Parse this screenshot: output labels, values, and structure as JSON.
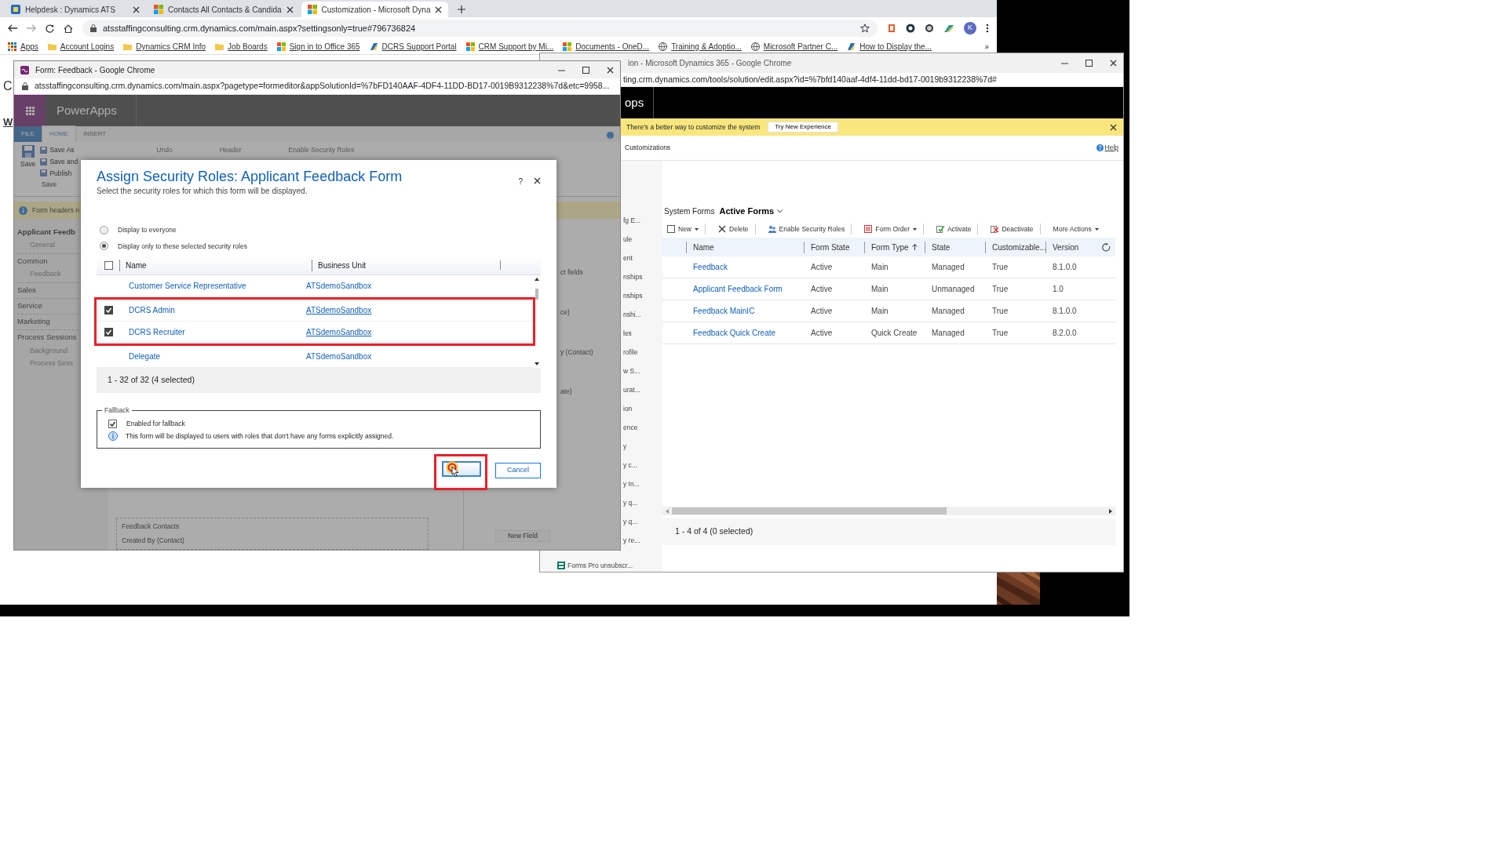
{
  "browser": {
    "tabs": [
      {
        "title": "Helpdesk : Dynamics ATS",
        "selected": false
      },
      {
        "title": "Contacts All Contacts & Candida",
        "selected": false
      },
      {
        "title": "Customization - Microsoft Dyna",
        "selected": true
      }
    ],
    "url": "atsstaffingconsulting.crm.dynamics.com/main.aspx?settingsonly=true#796736824",
    "profile_initial": "K",
    "bookmarks": [
      {
        "label": "Apps",
        "kind": "apps"
      },
      {
        "label": "Account Logins",
        "kind": "folder"
      },
      {
        "label": "Dynamics CRM Info",
        "kind": "folder"
      },
      {
        "label": "Job Boards",
        "kind": "folder"
      },
      {
        "label": "Sign in to Office 365",
        "kind": "windows"
      },
      {
        "label": "DCRS Support Portal",
        "kind": "site"
      },
      {
        "label": "CRM Support by Mi...",
        "kind": "windows"
      },
      {
        "label": "Documents - OneD...",
        "kind": "windows"
      },
      {
        "label": "Training & Adoptio...",
        "kind": "globe"
      },
      {
        "label": "Microsoft Partner C...",
        "kind": "globe"
      },
      {
        "label": "How to Display the...",
        "kind": "site"
      }
    ],
    "bookmarks_more": "»",
    "page_fragments": [
      "C",
      "W"
    ]
  },
  "solution_window": {
    "title": "ion - Microsoft Dynamics 365 - Google Chrome",
    "url": "ting.crm.dynamics.com/tools/solution/edit.aspx?id=%7bfd140aaf-4df4-11dd-bd17-0019b9312238%7d#",
    "app_name": "ops",
    "notice": "There's a better way to customize the system",
    "notice_button": "Try New Experience",
    "breadcrumb": "Customizations",
    "help": "Help",
    "nav_fragments": [
      "fg E...",
      "ule",
      "ent",
      "nships",
      "nships",
      "nshi...",
      "les",
      "rofile",
      "w S...",
      "urat...",
      "ion",
      "ence",
      "y",
      "y c...",
      "y In...",
      "y q...",
      "y q...",
      "y re..."
    ],
    "nav_tail": "Forms Pro unsubscr...",
    "view_label": "System Forms",
    "view_name": "Active Forms",
    "toolbar": [
      "New",
      "Delete",
      "Enable Security Roles",
      "Form Order",
      "Activate",
      "Deactivate",
      "More Actions"
    ],
    "columns": [
      "Name",
      "Form State",
      "Form Type",
      "State",
      "Customizable...",
      "Version"
    ],
    "rows": [
      {
        "name": "Feedback",
        "form_state": "Active",
        "form_type": "Main",
        "state": "Managed",
        "customizable": "True",
        "version": "8.1.0.0"
      },
      {
        "name": "Applicant Feedback Form",
        "form_state": "Active",
        "form_type": "Main",
        "state": "Unmanaged",
        "customizable": "True",
        "version": "1.0"
      },
      {
        "name": "Feedback MainIC",
        "form_state": "Active",
        "form_type": "Main",
        "state": "Managed",
        "customizable": "True",
        "version": "8.1.0.0"
      },
      {
        "name": "Feedback Quick Create",
        "form_state": "Active",
        "form_type": "Quick Create",
        "state": "Managed",
        "customizable": "True",
        "version": "8.2.0.0"
      }
    ],
    "footer": "1 - 4 of 4 (0 selected)"
  },
  "form_window": {
    "title": "Form: Feedback - Google Chrome",
    "url": "atsstaffingconsulting.crm.dynamics.com/main.aspx?pagetype=formeditor&appSolutionId=%7bFD140AAF-4DF4-11DD-BD17-0019B9312238%7d&etc=9958...",
    "app_name": "PowerApps",
    "ribbon_tabs": [
      {
        "label": "FILE",
        "selected": false
      },
      {
        "label": "HOME",
        "selected": true
      },
      {
        "label": "INSERT",
        "selected": false
      }
    ],
    "save_label": "Save",
    "save_commands": [
      "Save As",
      "Save and",
      "Publish"
    ],
    "group_label": "Save",
    "ribbon_more": [
      "Undo",
      "Header",
      "Enable Security Roles"
    ],
    "info": "Form headers n",
    "nav": [
      {
        "label": "Applicant Feedb",
        "children": [
          "General"
        ]
      },
      {
        "label": "Common",
        "children": [
          "Feedback"
        ]
      },
      {
        "label": "Sales"
      },
      {
        "label": "Service"
      },
      {
        "label": "Marketing"
      },
      {
        "label": "Process Sessions",
        "children": [
          "Background",
          "Process Sess"
        ]
      }
    ],
    "panel_fragments": [
      "ct fields",
      "ce)",
      "y (Contact)",
      "ate)"
    ],
    "section_title": "Feedback Contacts",
    "field": "Created By (Contact)",
    "new_field": "New Field"
  },
  "dialog": {
    "title": "Assign Security Roles: Applicant Feedback Form",
    "subtitle": "Select the security roles for which this form will be displayed.",
    "help": "?",
    "options": [
      {
        "label": "Display to everyone",
        "selected": false
      },
      {
        "label": "Display only to these selected security roles",
        "selected": true
      }
    ],
    "all_checked": false,
    "columns": [
      "Name",
      "Business Unit"
    ],
    "rows": [
      {
        "name": "Customer Service Representative",
        "unit": "ATSdemoSandbox",
        "checked": false
      },
      {
        "name": "DCRS Admin",
        "unit": "ATSdemoSandbox",
        "checked": true
      },
      {
        "name": "DCRS Recruiter",
        "unit": "ATSdemoSandbox",
        "checked": true
      },
      {
        "name": "Delegate",
        "unit": "ATSdemoSandbox",
        "checked": false
      }
    ],
    "footer": "1 - 32 of 32 (4 selected)",
    "fallback": {
      "legend": "Fallback",
      "label": "Enabled for fallback",
      "checked": true,
      "note": "This form will be displayed to users with roles that don't have any forms explicitly assigned."
    },
    "cancel": "Cancel"
  }
}
